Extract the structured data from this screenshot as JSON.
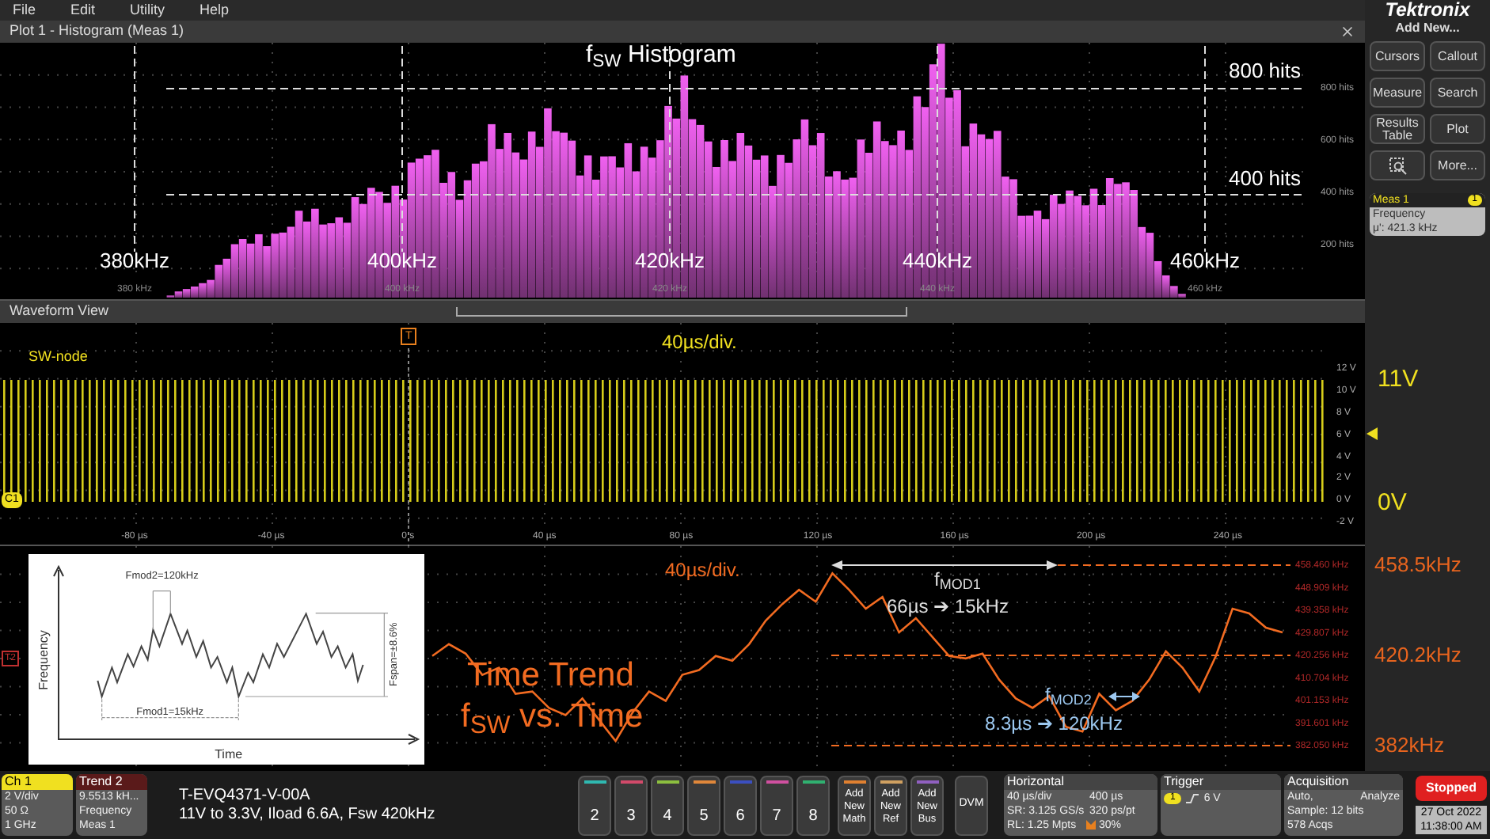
{
  "menu": [
    "File",
    "Edit",
    "Utility",
    "Help"
  ],
  "brand": {
    "logo": "Tektronix",
    "add_new": "Add New..."
  },
  "sidebar_buttons": [
    {
      "kind": "text",
      "label": "Cursors"
    },
    {
      "kind": "text",
      "label": "Callout"
    },
    {
      "kind": "text",
      "label": "Measure"
    },
    {
      "kind": "text",
      "label": "Search"
    },
    {
      "kind": "text",
      "label": "Results Table"
    },
    {
      "kind": "text",
      "label": "Plot"
    },
    {
      "kind": "icon"
    },
    {
      "kind": "text",
      "label": "More..."
    }
  ],
  "meas_badge": {
    "title": "Meas 1",
    "tag": "1",
    "lines": [
      "Frequency",
      "μ': 421.3 kHz"
    ]
  },
  "histogram": {
    "title": "Plot 1 - Histogram (Meas 1)",
    "heading": "f$_{SW}$ Histogram",
    "x_annotations": [
      "380kHz",
      "400kHz",
      "420kHz",
      "440kHz",
      "460kHz"
    ],
    "y_annotations": [
      "800 hits",
      "400 hits"
    ],
    "x_ticks": [
      "380 kHz",
      "400 kHz",
      "420 kHz",
      "440 kHz",
      "460 kHz"
    ],
    "y_ticks": [
      "800 hits",
      "600 hits",
      "400 hits",
      "200 hits"
    ]
  },
  "waveform": {
    "title": "Waveform View",
    "trigger_tag": "T",
    "channel_label": "SW-node",
    "scale": "40µs/div.",
    "channel_tag": "C1",
    "x_ticks": [
      "-80 µs",
      "-40 µs",
      "0 s",
      "40 µs",
      "80 µs",
      "120 µs",
      "160 µs",
      "200 µs",
      "240 µs"
    ],
    "y_ticks": [
      "12 V",
      "10 V",
      "8 V",
      "6 V",
      "4 V",
      "2 V",
      "0 V",
      "-2 V"
    ],
    "level_labels": [
      "11V",
      "0V"
    ]
  },
  "trend": {
    "scale": "40µs/div.",
    "trend_tag": "T2",
    "title_lines": [
      "Time Trend",
      "f$_{SW}$ vs. Time"
    ],
    "mod1": {
      "label": "f$_{MOD1}$",
      "value": "66µs ➔ 15kHz"
    },
    "mod2": {
      "label": "f$_{MOD2}$",
      "value": "8.3µs ➔ 120kHz"
    },
    "chart_data": {
      "type": "line",
      "grid": true,
      "ylim": [
        382.05,
        458.46
      ],
      "yticks": [
        {
          "value": 458.46,
          "label": "458.460 kHz"
        },
        {
          "value": 448.909,
          "label": "448.909 kHz"
        },
        {
          "value": 439.358,
          "label": "439.358 kHz"
        },
        {
          "value": 429.807,
          "label": "429.807 kHz"
        },
        {
          "value": 420.256,
          "label": "420.256 kHz"
        },
        {
          "value": 410.704,
          "label": "410.704 kHz"
        },
        {
          "value": 401.153,
          "label": "401.153 kHz"
        },
        {
          "value": 391.601,
          "label": "391.601 kHz"
        },
        {
          "value": 382.05,
          "label": "382.050 kHz"
        }
      ],
      "series": [
        {
          "color": "#f26b21",
          "values": [
            420,
            425,
            421,
            412,
            415,
            404,
            405,
            398,
            395,
            402,
            393,
            384,
            396,
            405,
            401,
            412,
            414,
            420,
            418,
            425,
            435,
            442,
            448,
            443,
            455,
            448,
            440,
            445,
            430,
            436,
            428,
            420,
            419,
            421,
            410,
            402,
            398,
            403,
            390,
            388,
            404,
            397,
            401,
            410,
            422,
            415,
            405,
            420,
            440,
            438,
            432,
            430
          ]
        }
      ]
    },
    "level_labels": [
      "458.5kHz",
      "420.2kHz",
      "382kHz"
    ],
    "inset": {
      "fmod2": "Fmod2=120kHz",
      "fmod1": "Fmod1=15kHz",
      "fspan": "Fspan=±8.6%",
      "ylabel": "Frequency",
      "xlabel": "Time"
    }
  },
  "bottom": {
    "ch1": {
      "title": "Ch 1",
      "lines": [
        "2 V/div",
        "50 Ω",
        "1 GHz"
      ]
    },
    "trend2": {
      "title": "Trend 2",
      "lines": [
        "9.5513 kH...",
        "Frequency",
        "Meas 1"
      ]
    },
    "description": [
      "T-EVQ4371-V-00A",
      "11V to 3.3V, Iload 6.6A, Fsw 420kHz"
    ],
    "channels": [
      {
        "label": "2",
        "color": "#2fb8b0"
      },
      {
        "label": "3",
        "color": "#d24a6a"
      },
      {
        "label": "4",
        "color": "#8cbf3f"
      },
      {
        "label": "5",
        "color": "#e0873a"
      },
      {
        "label": "6",
        "color": "#3b4fc0"
      },
      {
        "label": "7",
        "color": "#d050a0"
      },
      {
        "label": "8",
        "color": "#30b070"
      }
    ],
    "add_buttons": [
      {
        "label": "Add New Math",
        "color": "#e08030"
      },
      {
        "label": "Add New Ref",
        "color": "#d0a060"
      },
      {
        "label": "Add New Bus",
        "color": "#9060c0"
      }
    ],
    "dvm": "DVM",
    "horizontal": {
      "title": "Horizontal",
      "rows": [
        [
          "40 µs/div",
          "400 µs"
        ],
        [
          "SR: 3.125 GS/s",
          "320 ps/pt"
        ],
        [
          "RL: 1.25 Mpts",
          "30%"
        ]
      ]
    },
    "trigger": {
      "title": "Trigger",
      "source": "1",
      "level": "6 V"
    },
    "acquisition": {
      "title": "Acquisition",
      "rows": [
        [
          "Auto,",
          "Analyze"
        ],
        [
          "Sample: 12 bits"
        ],
        [
          "578 Acqs"
        ]
      ]
    },
    "status": "Stopped",
    "date": "27 Oct 2022",
    "time": "11:38:00 AM"
  }
}
